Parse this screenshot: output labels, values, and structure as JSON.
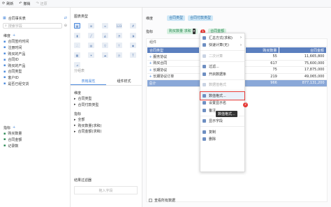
{
  "toolbar": {
    "refresh": "刷新",
    "undo": "撤销",
    "redo": "还原"
  },
  "left": {
    "dataset_title": "合同事实表",
    "search_placeholder": "搜索字段",
    "dimension_title": "维度",
    "dimensions": [
      "合同签约时间",
      "注册时间",
      "购买的产品",
      "合同ID",
      "购买的产品",
      "合同类型",
      "客户ID",
      "是否已经交货"
    ],
    "metric_title": "指标",
    "metrics": [
      "购买数量",
      "合同金额",
      "记录数"
    ]
  },
  "mid": {
    "chart_type_title": "图表类型",
    "chart_type_icons": [
      "table-icon",
      "cross-table-icon",
      "detail-table-icon",
      "kpi-icon",
      "number-icon",
      "bar-icon",
      "line-icon",
      "area-icon",
      "pie-icon",
      "gauge-icon",
      "scatter-icon",
      "stacked-icon",
      "funnel-icon",
      "tree-icon",
      "map-icon",
      "heat-icon",
      "radar-icon",
      "word-cloud-icon",
      "dashboard-icon",
      "text-icon",
      "combo-icon"
    ],
    "group_label": "分组表",
    "tab_table_attr": "表格属性",
    "tab_component_style": "组件样式",
    "dim_section": "维度",
    "dim_items": [
      "合同类型",
      "合同付款类型"
    ],
    "metric_section": "指标",
    "metric_items": [
      "全部",
      "购买数量(求和)",
      "合同金额(求和)"
    ],
    "filter_title": "结果过滤器",
    "filter_placeholder": "拖入字段"
  },
  "right": {
    "dim_label": "维度",
    "dim_tags": [
      "合同类型",
      "合同付款类型"
    ],
    "metric_label": "指标",
    "metric_tags": [
      {
        "text": "购买数量 (求和)",
        "short": "购买数量 求和"
      },
      {
        "text": "合同金额 (求和)",
        "short": "合同金额"
      }
    ],
    "component_title": "组件",
    "table": {
      "headers": [
        "合同类型",
        "合同付款类型",
        "购买数量",
        "合同金额"
      ],
      "rows": [
        [
          "服务协议",
          "",
          "55",
          "11,665,800"
        ],
        [
          "购买合同",
          "",
          "617",
          "75,600,000"
        ],
        [
          "长期协议",
          "",
          "75",
          "17,875,000"
        ],
        [
          "长期协议订单",
          "",
          "219",
          "49,065,000"
        ]
      ],
      "total": [
        "总计",
        "",
        "966",
        "877,131,200"
      ]
    },
    "view_all": "查看所有数据"
  },
  "menu": {
    "items": [
      {
        "label": "汇总方式(求和)",
        "icon": "sum-icon",
        "arrow": true,
        "state": "normal"
      },
      {
        "label": "快速计算(无)",
        "icon": "calc-icon",
        "arrow": true,
        "state": "normal"
      },
      {
        "label": "二次计算",
        "icon": "recalc-icon",
        "arrow": false,
        "state": "disabled"
      },
      {
        "label": "过滤...",
        "icon": "filter-icon",
        "arrow": false,
        "state": "normal"
      },
      {
        "label": "开启数据条",
        "icon": "databar-icon",
        "arrow": false,
        "state": "normal"
      },
      {
        "label": "数据值格式",
        "icon": "format-icon",
        "arrow": false,
        "state": "disabled"
      },
      {
        "label": "数值格式...",
        "icon": "number-format-icon",
        "arrow": false,
        "state": "highlight"
      },
      {
        "label": "设置显示名",
        "icon": "rename-icon",
        "arrow": false,
        "state": "normal"
      },
      {
        "label": "备注",
        "icon": "note-icon",
        "arrow": false,
        "state": "normal"
      },
      {
        "label": "显示字段",
        "icon": "show-field-icon",
        "arrow": false,
        "state": "normal"
      },
      {
        "label": "复制",
        "icon": "copy-icon",
        "arrow": false,
        "state": "normal"
      },
      {
        "label": "删除",
        "icon": "delete-icon",
        "arrow": false,
        "state": "normal"
      }
    ],
    "tooltip": "数值格式...",
    "badge1": "1",
    "badge2": "2"
  }
}
